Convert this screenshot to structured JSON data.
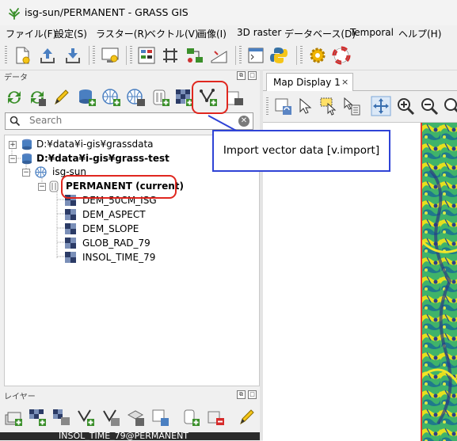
{
  "window": {
    "title": "isg-sun/PERMANENT - GRASS GIS"
  },
  "menu": [
    "ファイル(F)",
    "設定(S)",
    "ラスター(R)",
    "ベクトル(V)",
    "画像(I)",
    "3D raster",
    "データベース(D)",
    "Temporal",
    "ヘルプ(H)"
  ],
  "data_panel": {
    "title": "データ",
    "search_placeholder": "Search",
    "tree": [
      {
        "label": "D:¥data¥i-gis¥grassdata",
        "bold": false
      },
      {
        "label": "D:¥data¥i-gis¥grass-test",
        "bold": true
      },
      {
        "label": "isg-sun",
        "bold": false
      },
      {
        "label": "PERMANENT  (current)",
        "bold": true
      },
      {
        "label": "DEM_50CM_ISG",
        "bold": false
      },
      {
        "label": "DEM_ASPECT",
        "bold": false
      },
      {
        "label": "DEM_SLOPE",
        "bold": false
      },
      {
        "label": "GLOB_RAD_79",
        "bold": false
      },
      {
        "label": "INSOL_TIME_79",
        "bold": false
      }
    ]
  },
  "layer_panel": {
    "title": "レイヤー",
    "first_layer": "INSOL_TIME_79@PERMANENT"
  },
  "map_display": {
    "tab_label": "Map Display 1",
    "close_label": "×"
  },
  "annotation": {
    "callout": "Import vector data [v.import]"
  },
  "colors": {
    "highlight": "#e0271f",
    "callout_border": "#2f43d6",
    "raster_edge": "#e23c2e"
  }
}
